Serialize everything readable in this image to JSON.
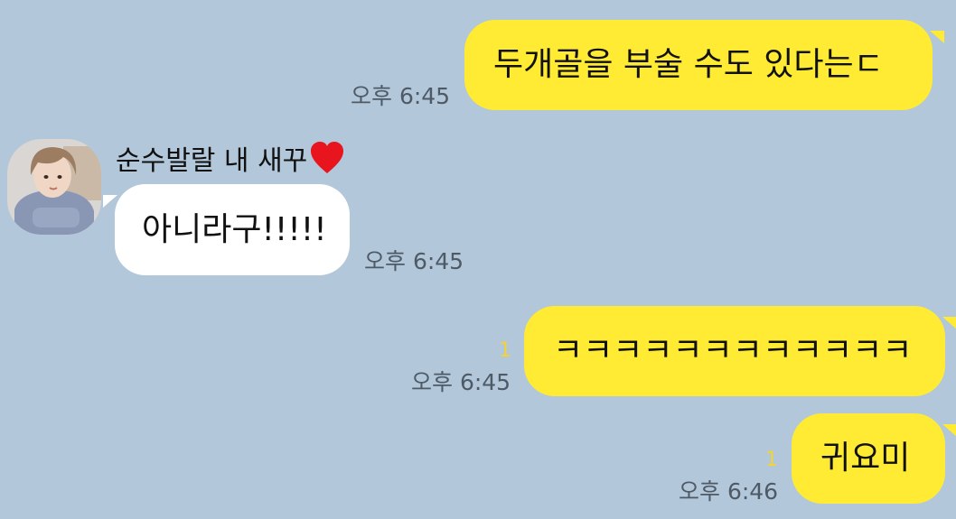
{
  "theme": {
    "background": "#B2C7D9",
    "outgoing_bubble": "#FFEB33",
    "incoming_bubble": "#FFFFFF",
    "time_color": "#4E5A66",
    "unread_color": "#F2D335",
    "heart_color": "#E8141E"
  },
  "contact": {
    "name": "순수발랄 내 새꾸",
    "name_emoji": "heart-icon"
  },
  "messages": [
    {
      "direction": "outgoing",
      "text": "두개골을 부술 수도 있다는ㄷ",
      "time": "오후 6:45",
      "unread": ""
    },
    {
      "direction": "incoming",
      "text": "아니라구!!!!!",
      "time": "오후 6:45",
      "unread": ""
    },
    {
      "direction": "outgoing",
      "text": "ㅋㅋㅋㅋㅋㅋㅋㅋㅋㅋㅋㅋ",
      "time": "오후 6:45",
      "unread": "1"
    },
    {
      "direction": "outgoing",
      "text": "귀요미",
      "time": "오후 6:46",
      "unread": "1"
    }
  ]
}
